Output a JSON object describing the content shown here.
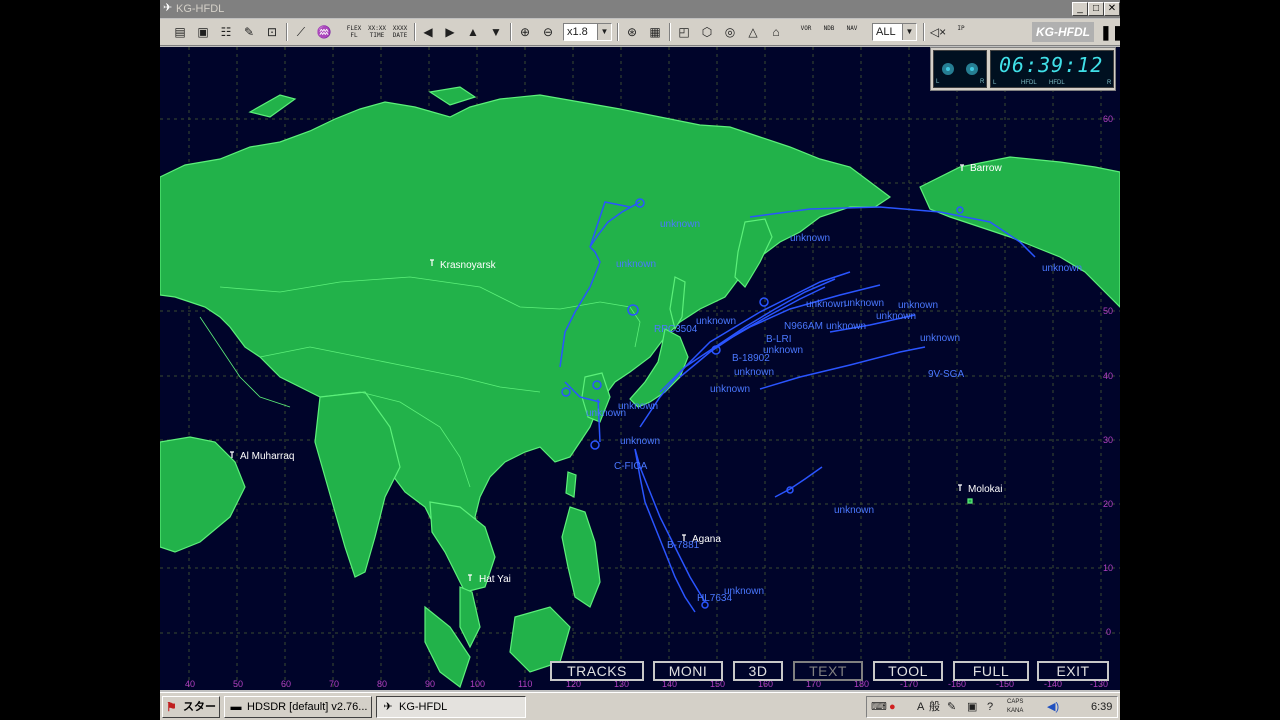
{
  "window": {
    "title": "KG-HFDL",
    "min": "_",
    "max": "□",
    "close": "✕"
  },
  "toolbar": {
    "zoom_value": "x1.8",
    "filter_value": "ALL",
    "brand": "KG-HFDL",
    "tiny_labels": {
      "flex_fl": "FLEX FL",
      "time": "XX:XX TIME",
      "date": "XXXX DATE",
      "vor": "VOR",
      "ndb": "NDB",
      "nav": "NAV",
      "ip": "IP"
    }
  },
  "hud": {
    "clock": "06:39:12",
    "meter_l": "L",
    "meter_r": "R",
    "hfdl_a": "HFDL",
    "hfdl_b": "HFDL"
  },
  "cities": [
    {
      "name": "Barrow"
    },
    {
      "name": "Krasnoyarsk"
    },
    {
      "name": "Al Muharraq"
    },
    {
      "name": "Molokai"
    },
    {
      "name": "Agana"
    },
    {
      "name": "Hat Yai"
    }
  ],
  "flights": [
    "unknown",
    "unknown",
    "unknown",
    "unknown",
    "RPC3504",
    "unknown",
    "unknown",
    "N966AM",
    "unknown",
    "B-LRI",
    "unknown",
    "B-18902",
    "unknown",
    "unknown",
    "unknown",
    "9V-SGA",
    "unknown",
    "unknown",
    "unknown",
    "unknown",
    "unknown",
    "unknown",
    "C-FICA",
    "unknown",
    "B-7881",
    "unknown",
    "HL7634"
  ],
  "axes": {
    "lat": [
      "60",
      "50",
      "40",
      "30",
      "20",
      "10",
      "0"
    ],
    "lon": [
      "40",
      "50",
      "60",
      "70",
      "80",
      "90",
      "100",
      "110",
      "120",
      "130",
      "140",
      "150",
      "160",
      "170",
      "180",
      "-170",
      "-160",
      "-150",
      "-140",
      "-130"
    ]
  },
  "buttons": {
    "tracks": "TRACKS",
    "moni": "MONI",
    "three_d": "3D",
    "text": "TEXT",
    "tool": "TOOL",
    "full": "FULL",
    "exit": "EXIT"
  },
  "taskbar": {
    "start": "スタート",
    "tasks": [
      {
        "label": "HDSDR  [default]  v2.76..."
      },
      {
        "label": "KG-HFDL"
      }
    ],
    "ime_a": "A",
    "ime_b": "般",
    "caps": "CAPS",
    "kana": "KANA",
    "time": "6:39"
  },
  "colors": {
    "land": "#22b24a",
    "land_border": "#5cf07a",
    "ocean": "#00042a",
    "track": "#2a55ff",
    "grid": "#3a4a30"
  }
}
